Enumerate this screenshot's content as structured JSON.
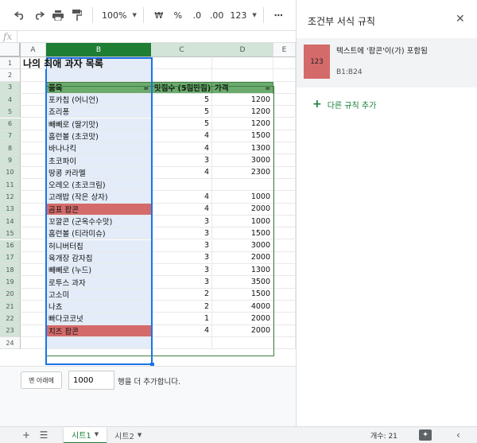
{
  "toolbar": {
    "zoom": "100%",
    "currency": "₩",
    "percent": "%",
    "dec_decrease": ".0",
    "dec_increase": ".00",
    "number_format": "123"
  },
  "formula": {
    "fx_label": "fx"
  },
  "columns": [
    "A",
    "B",
    "C",
    "D",
    "E"
  ],
  "sheet": {
    "title": "나의 최애 과자 목록",
    "headers": [
      "품목",
      "맛점수 (5점만점)",
      "가격"
    ],
    "rows": [
      {
        "name": "포카칩 (어니언)",
        "score": "5",
        "price": "1200"
      },
      {
        "name": "죠리퐁",
        "score": "5",
        "price": "1200"
      },
      {
        "name": "빼빼로 (딸기맛)",
        "score": "5",
        "price": "1200"
      },
      {
        "name": "홈런볼 (초코맛)",
        "score": "4",
        "price": "1500"
      },
      {
        "name": "바나나킥",
        "score": "4",
        "price": "1300"
      },
      {
        "name": "초코파이",
        "score": "3",
        "price": "3000"
      },
      {
        "name": "땅콩 카라멜",
        "score": "4",
        "price": "2300"
      },
      {
        "name": "오레오 (초코크림)",
        "score": "",
        "price": ""
      },
      {
        "name": "고래밥 (작은 상자)",
        "score": "4",
        "price": "1000"
      },
      {
        "name": "곰표 팝콘",
        "score": "4",
        "price": "2000",
        "highlight": true
      },
      {
        "name": "꼬깔콘 (군옥수수맛)",
        "score": "3",
        "price": "1000"
      },
      {
        "name": "홈런볼 (티라미슈)",
        "score": "3",
        "price": "1500"
      },
      {
        "name": "허니버터칩",
        "score": "3",
        "price": "3000"
      },
      {
        "name": "육개장 감자칩",
        "score": "3",
        "price": "2000"
      },
      {
        "name": "빼빼로 (누드)",
        "score": "3",
        "price": "1300"
      },
      {
        "name": "로투스 과자",
        "score": "3",
        "price": "3500"
      },
      {
        "name": "고소미",
        "score": "2",
        "price": "1500"
      },
      {
        "name": "나쵸",
        "score": "2",
        "price": "4000"
      },
      {
        "name": "빠다코코넛",
        "score": "1",
        "price": "2000"
      },
      {
        "name": "치즈 팝콘",
        "score": "4",
        "price": "2000",
        "highlight": true
      }
    ],
    "row_numbers": [
      "1",
      "2",
      "3",
      "4",
      "5",
      "6",
      "7",
      "8",
      "9",
      "10",
      "11",
      "12",
      "13",
      "14",
      "15",
      "16",
      "17",
      "18",
      "19",
      "20",
      "21",
      "22",
      "23",
      "24"
    ]
  },
  "add_rows": {
    "button": "맨 아래에",
    "count": "1000",
    "suffix": "행을 더 추가합니다."
  },
  "tabs": {
    "sheets": [
      "시트1",
      "시트2"
    ],
    "active": "시트1",
    "count_label": "개수: 21"
  },
  "panel": {
    "title": "조건부 서식 규칙",
    "rule": {
      "preview": "123",
      "description": "텍스트에 '팝콘'이(가) 포함됨",
      "range": "B1:B24",
      "color": "#d46a6a"
    },
    "add_rule": "다른 규칙 추가"
  },
  "colors": {
    "header_green": "#6bab6d",
    "column_b_fill": "#e3ecf8",
    "highlight_red": "#d46a6a",
    "accent_green": "#188038"
  }
}
